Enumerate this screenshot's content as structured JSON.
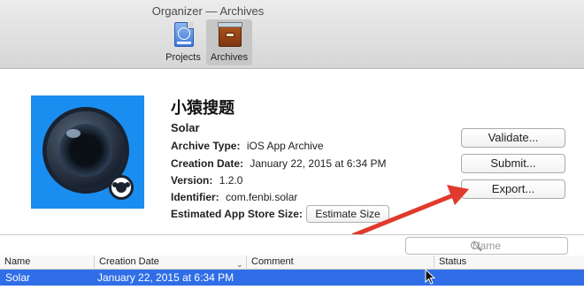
{
  "window": {
    "title": "Organizer — Archives"
  },
  "toolbar": {
    "projects_label": "Projects",
    "archives_label": "Archives"
  },
  "archive": {
    "app_name_cn": "小猿搜题",
    "app_name": "Solar",
    "fields": {
      "archive_type_label": "Archive Type:",
      "archive_type_value": "iOS App Archive",
      "creation_date_label": "Creation Date:",
      "creation_date_value": "January 22, 2015 at 6:34 PM",
      "version_label": "Version:",
      "version_value": "1.2.0",
      "identifier_label": "Identifier:",
      "identifier_value": "com.fenbi.solar",
      "est_size_label": "Estimated App Store Size:"
    },
    "estimate_button": "Estimate Size"
  },
  "actions": {
    "validate": "Validate...",
    "submit": "Submit...",
    "export": "Export..."
  },
  "search": {
    "placeholder": "Name"
  },
  "table": {
    "columns": [
      "Name",
      "Creation Date",
      "Comment",
      "Status"
    ],
    "rows": [
      {
        "name": "Solar",
        "creation_date": "January 22, 2015 at 6:34 PM",
        "comment": "",
        "status": ""
      }
    ]
  },
  "colors": {
    "selection": "#2f6ee6",
    "app_icon_bg": "#1a8ef0",
    "annotation_arrow": "#e03a2e"
  }
}
